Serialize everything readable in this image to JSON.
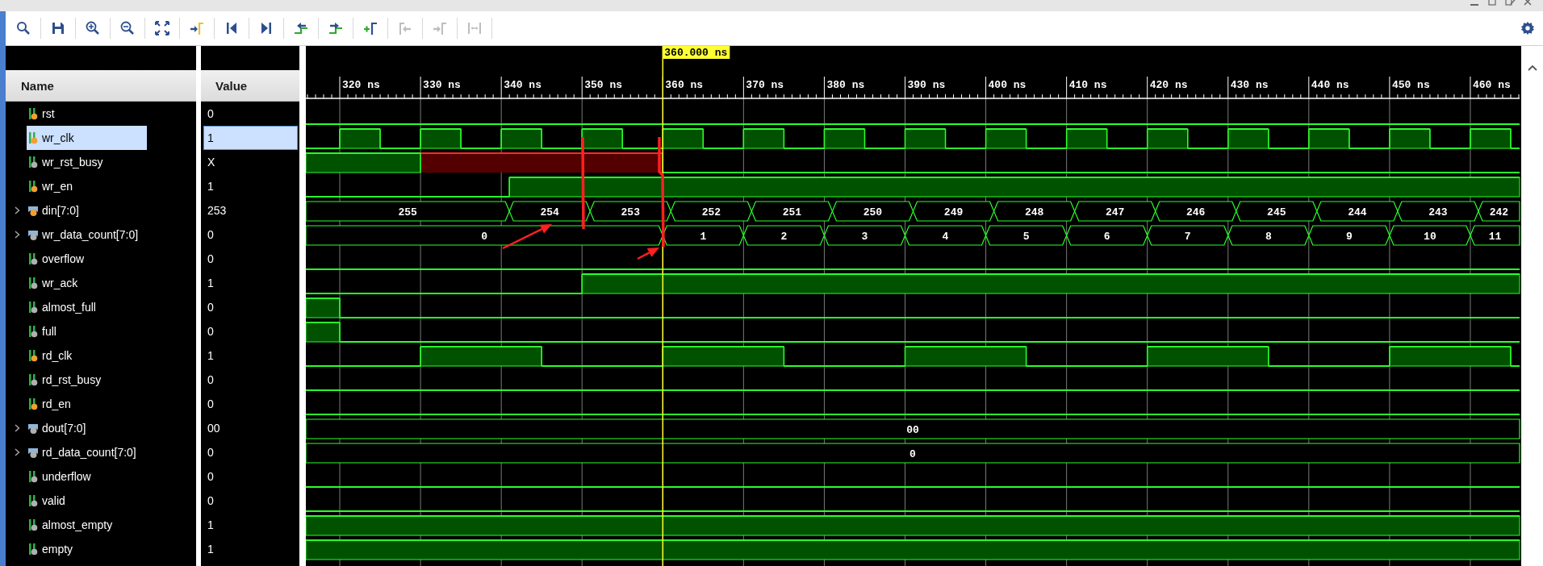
{
  "toolbar": [
    {
      "kind": "search",
      "disabled": false
    },
    {
      "kind": "save",
      "disabled": false
    },
    {
      "kind": "zoom_in",
      "disabled": false
    },
    {
      "kind": "zoom_out",
      "disabled": false
    },
    {
      "kind": "zoom_fit",
      "disabled": false
    },
    {
      "kind": "goto_cursor",
      "disabled": false
    },
    {
      "kind": "goto_start",
      "disabled": false
    },
    {
      "kind": "goto_end",
      "disabled": false
    },
    {
      "kind": "prev_transition",
      "disabled": false
    },
    {
      "kind": "next_transition",
      "disabled": false
    },
    {
      "kind": "add_marker",
      "disabled": false
    },
    {
      "kind": "prev_marker",
      "disabled": true
    },
    {
      "kind": "next_marker",
      "disabled": true
    },
    {
      "kind": "swap_cursors",
      "disabled": true
    }
  ],
  "columns": {
    "name": "Name",
    "value": "Value"
  },
  "signals": [
    {
      "name": "rst",
      "value": "0",
      "kind": "bit",
      "input": true,
      "selected": false
    },
    {
      "name": "wr_clk",
      "value": "1",
      "kind": "bit",
      "input": true,
      "selected": true
    },
    {
      "name": "wr_rst_busy",
      "value": "X",
      "kind": "bit",
      "input": false,
      "selected": false
    },
    {
      "name": "wr_en",
      "value": "1",
      "kind": "bit",
      "input": true,
      "selected": false
    },
    {
      "name": "din[7:0]",
      "value": "253",
      "kind": "bus",
      "input": true,
      "selected": false,
      "expanded": false,
      "segments": [
        "255",
        "254",
        "253",
        "252",
        "251",
        "250",
        "249",
        "248",
        "247",
        "246",
        "245",
        "244",
        "243",
        "242"
      ]
    },
    {
      "name": "wr_data_count[7:0]",
      "value": "0",
      "kind": "bus",
      "input": false,
      "selected": false,
      "expanded": false,
      "segments": [
        "0",
        "1",
        "2",
        "3",
        "4",
        "5",
        "6",
        "7",
        "8",
        "9",
        "10",
        "11"
      ]
    },
    {
      "name": "overflow",
      "value": "0",
      "kind": "bit",
      "input": false,
      "selected": false
    },
    {
      "name": "wr_ack",
      "value": "1",
      "kind": "bit",
      "input": false,
      "selected": false
    },
    {
      "name": "almost_full",
      "value": "0",
      "kind": "bit",
      "input": false,
      "selected": false
    },
    {
      "name": "full",
      "value": "0",
      "kind": "bit",
      "input": false,
      "selected": false
    },
    {
      "name": "rd_clk",
      "value": "1",
      "kind": "bit",
      "input": true,
      "selected": false
    },
    {
      "name": "rd_rst_busy",
      "value": "0",
      "kind": "bit",
      "input": false,
      "selected": false
    },
    {
      "name": "rd_en",
      "value": "0",
      "kind": "bit",
      "input": true,
      "selected": false
    },
    {
      "name": "dout[7:0]",
      "value": "00",
      "kind": "bus",
      "input": false,
      "selected": false,
      "expanded": false,
      "segments": [
        "00"
      ]
    },
    {
      "name": "rd_data_count[7:0]",
      "value": "0",
      "kind": "bus",
      "input": false,
      "selected": false,
      "expanded": false,
      "segments": [
        "0"
      ]
    },
    {
      "name": "underflow",
      "value": "0",
      "kind": "bit",
      "input": false,
      "selected": false
    },
    {
      "name": "valid",
      "value": "0",
      "kind": "bit",
      "input": false,
      "selected": false
    },
    {
      "name": "almost_empty",
      "value": "1",
      "kind": "bit",
      "input": false,
      "selected": false
    },
    {
      "name": "empty",
      "value": "1",
      "kind": "bit",
      "input": false,
      "selected": false
    }
  ],
  "timeline": {
    "ticks": [
      "320 ns",
      "330 ns",
      "340 ns",
      "350 ns",
      "360 ns",
      "370 ns",
      "380 ns",
      "390 ns",
      "400 ns",
      "410 ns",
      "420 ns",
      "430 ns",
      "440 ns",
      "450 ns",
      "460 ns"
    ],
    "cursor": "360.000 ns"
  }
}
